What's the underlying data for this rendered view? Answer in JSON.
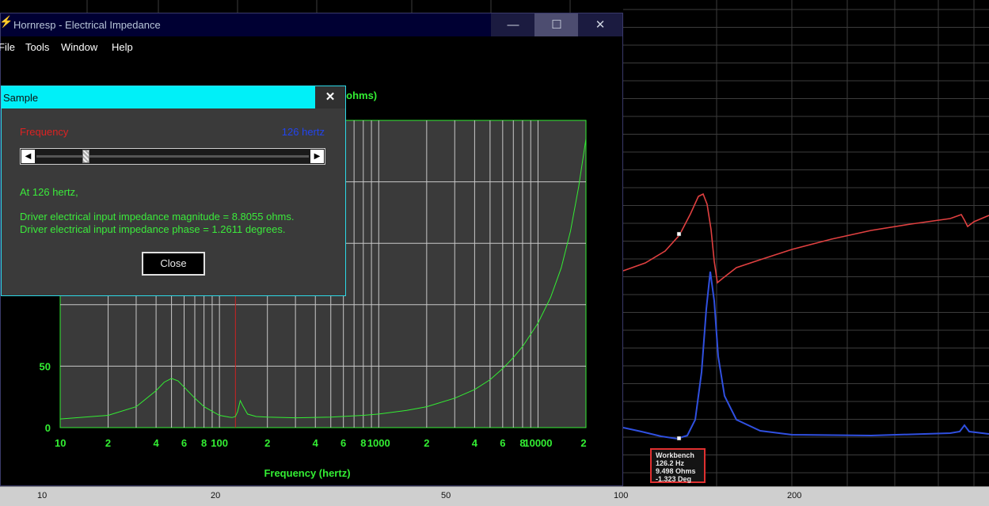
{
  "window": {
    "title": "Hornresp - Electrical Impedance",
    "controls": {
      "minimize": "—",
      "maximize": "☐",
      "close": "✕"
    }
  },
  "menu": [
    "File",
    "Tools",
    "Window",
    "Help"
  ],
  "plot": {
    "title": "Electrical Impedance (ohms)",
    "x_label": "Frequency (hertz)",
    "x_tick_labels": [
      "10",
      "2",
      "4",
      "6",
      "8",
      "100",
      "2",
      "4",
      "6",
      "8",
      "1000",
      "2",
      "4",
      "6",
      "8",
      "10000",
      "2"
    ],
    "y_tick_labels": [
      "0",
      "50"
    ]
  },
  "dialog": {
    "title": "Sample",
    "close_glyph": "✕",
    "frequency_label": "Frequency",
    "frequency_value": "126 hertz",
    "slider_left": "◀",
    "slider_right": "▶",
    "at_line": "At 126 hertz,",
    "magnitude_line": "Driver electrical input impedance magnitude = 8.8055 ohms.",
    "phase_line": "Driver electrical input impedance phase = 1.2611 degrees.",
    "close_label": "Close",
    "slider_position": 0.17
  },
  "workbench_bottom_axis": [
    "10",
    "20",
    "50",
    "100",
    "200"
  ],
  "workbench_readout": {
    "name": "Workbench",
    "frequency": "126.2 Hz",
    "impedance": "9.498 Ohms",
    "phase": "-1.323 Deg"
  },
  "chart_data": {
    "type": "line",
    "title": "Electrical Impedance (ohms)",
    "xlabel": "Frequency (hertz)",
    "ylabel": "",
    "x_scale": "log",
    "xlim": [
      10,
      20000
    ],
    "ylim": [
      0,
      250
    ],
    "grid": true,
    "marker_x": 126,
    "series": [
      {
        "color": "#33ee33",
        "x": [
          10,
          20,
          30,
          40,
          45,
          50,
          55,
          60,
          70,
          80,
          100,
          115,
          120,
          126,
          130,
          135,
          140,
          150,
          170,
          200,
          300,
          500,
          800,
          1000,
          1500,
          2000,
          3000,
          4000,
          5000,
          6000,
          7000,
          8000,
          10000,
          12000,
          14000,
          16000,
          18000,
          20000
        ],
        "y": [
          7,
          10,
          17,
          30,
          37,
          40,
          38,
          33,
          24,
          17,
          10,
          8.5,
          8.2,
          9,
          13,
          22,
          18,
          11,
          9,
          8.5,
          8,
          8.5,
          10,
          11,
          14,
          17,
          24,
          31,
          39,
          48,
          57,
          66,
          85,
          106,
          130,
          160,
          196,
          235
        ]
      }
    ],
    "colors": {
      "curve": "#33ee33",
      "grid": "#c8c8c8",
      "plot_bg": "#3a3a3a",
      "axis_text": "#33ee33",
      "marker": "#cc2222"
    }
  },
  "background_curves": {
    "impedance_color": "#e04040",
    "phase_color": "#3050e0"
  }
}
